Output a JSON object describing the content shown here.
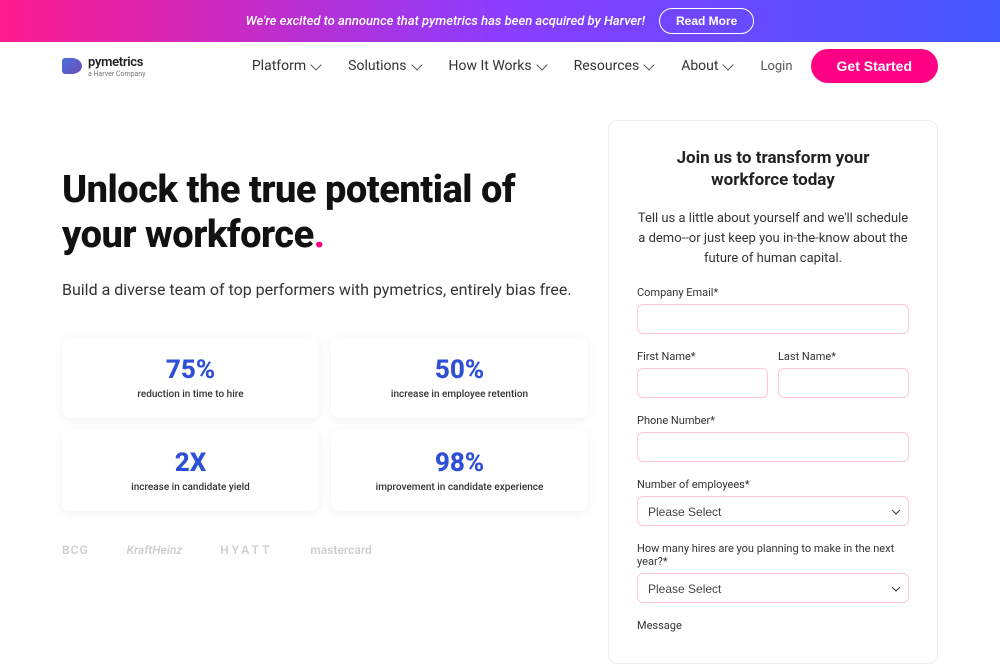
{
  "announcement": {
    "text": "We're excited to announce that pymetrics has been acquired by Harver!",
    "cta": "Read More"
  },
  "brand": {
    "name": "pymetrics",
    "sub": "a Harver Company"
  },
  "nav": {
    "items": [
      "Platform",
      "Solutions",
      "How It Works",
      "Resources",
      "About"
    ],
    "login": "Login",
    "cta": "Get Started"
  },
  "hero": {
    "headline_a": "Unlock the true potential of your workforce",
    "dot": ".",
    "sub": "Build a diverse team of top performers with pymetrics, entirely bias free."
  },
  "stats": [
    {
      "num": "75%",
      "label": "reduction in time to hire"
    },
    {
      "num": "50%",
      "label": "increase in employee retention"
    },
    {
      "num": "2X",
      "label": "increase in candidate yield"
    },
    {
      "num": "98%",
      "label": "improvement in candidate experience"
    }
  ],
  "clients": [
    "BCG",
    "KraftHeinz",
    "HYATT",
    "mastercard"
  ],
  "form": {
    "title": "Join us to transform your workforce today",
    "desc": "Tell us a little about yourself and we'll schedule a demo--or just keep you in-the-know about the future of human capital.",
    "email_label": "Company Email*",
    "fname_label": "First Name*",
    "lname_label": "Last Name*",
    "phone_label": "Phone Number*",
    "employees_label": "Number of employees*",
    "hires_label": "How many hires are you planning to make in the next year?*",
    "message_label": "Message",
    "select_placeholder": "Please Select"
  }
}
